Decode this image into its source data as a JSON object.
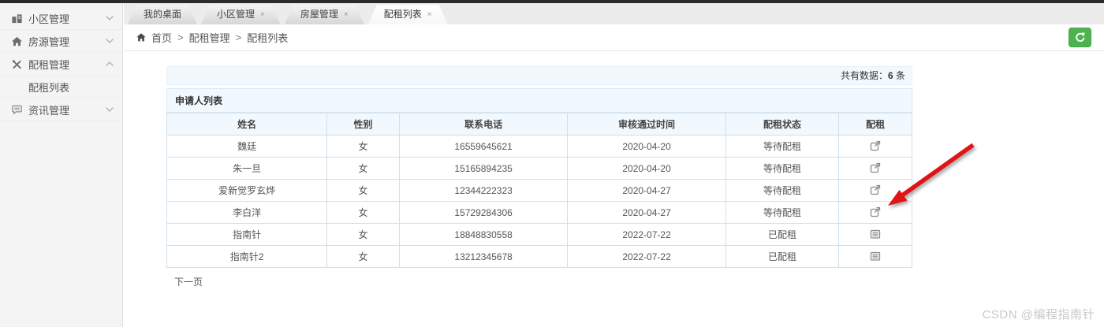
{
  "sidebar": {
    "items": [
      {
        "label": "小区管理",
        "icon": "building-icon",
        "state": "collapsed"
      },
      {
        "label": "房源管理",
        "icon": "home-icon",
        "state": "collapsed"
      },
      {
        "label": "配租管理",
        "icon": "wrench-icon",
        "state": "expanded"
      },
      {
        "label": "配租列表",
        "icon": "none",
        "state": "submenu-active"
      },
      {
        "label": "资讯管理",
        "icon": "comment-icon",
        "state": "collapsed"
      }
    ]
  },
  "tabs": [
    {
      "label": "我的桌面",
      "closable": false,
      "active": false
    },
    {
      "label": "小区管理",
      "closable": true,
      "active": false
    },
    {
      "label": "房屋管理",
      "closable": true,
      "active": false
    },
    {
      "label": "配租列表",
      "closable": true,
      "active": true
    }
  ],
  "ui": {
    "close_glyph": "×"
  },
  "breadcrumb": {
    "separator": ">",
    "items": [
      "首页",
      "配租管理",
      "配租列表"
    ]
  },
  "summary": {
    "prefix": "共有数据：",
    "count": "6",
    "suffix": " 条"
  },
  "panel": {
    "title": "申请人列表"
  },
  "table": {
    "headers": [
      "姓名",
      "性别",
      "联系电话",
      "审核通过时间",
      "配租状态",
      "配租"
    ],
    "rows": [
      {
        "name": "魏廷",
        "gender": "女",
        "phone": "16559645621",
        "date": "2020-04-20",
        "status": "等待配租",
        "action": "assign"
      },
      {
        "name": "朱一旦",
        "gender": "女",
        "phone": "15165894235",
        "date": "2020-04-20",
        "status": "等待配租",
        "action": "assign"
      },
      {
        "name": "爱新觉罗玄烨",
        "gender": "女",
        "phone": "12344222323",
        "date": "2020-04-27",
        "status": "等待配租",
        "action": "assign"
      },
      {
        "name": "李白洋",
        "gender": "女",
        "phone": "15729284306",
        "date": "2020-04-27",
        "status": "等待配租",
        "action": "assign"
      },
      {
        "name": "指南针",
        "gender": "女",
        "phone": "18848830558",
        "date": "2022-07-22",
        "status": "已配租",
        "action": "detail"
      },
      {
        "name": "指南针2",
        "gender": "女",
        "phone": "13212345678",
        "date": "2022-07-22",
        "status": "已配租",
        "action": "detail"
      }
    ]
  },
  "pagination": {
    "next": "下一页"
  },
  "watermark": "CSDN @编程指南针",
  "colors": {
    "accent_green": "#4db34f",
    "arrow_red": "#e01414",
    "panel_blue": "#f2f9fe",
    "topbar_dark": "#2b2b2b"
  }
}
